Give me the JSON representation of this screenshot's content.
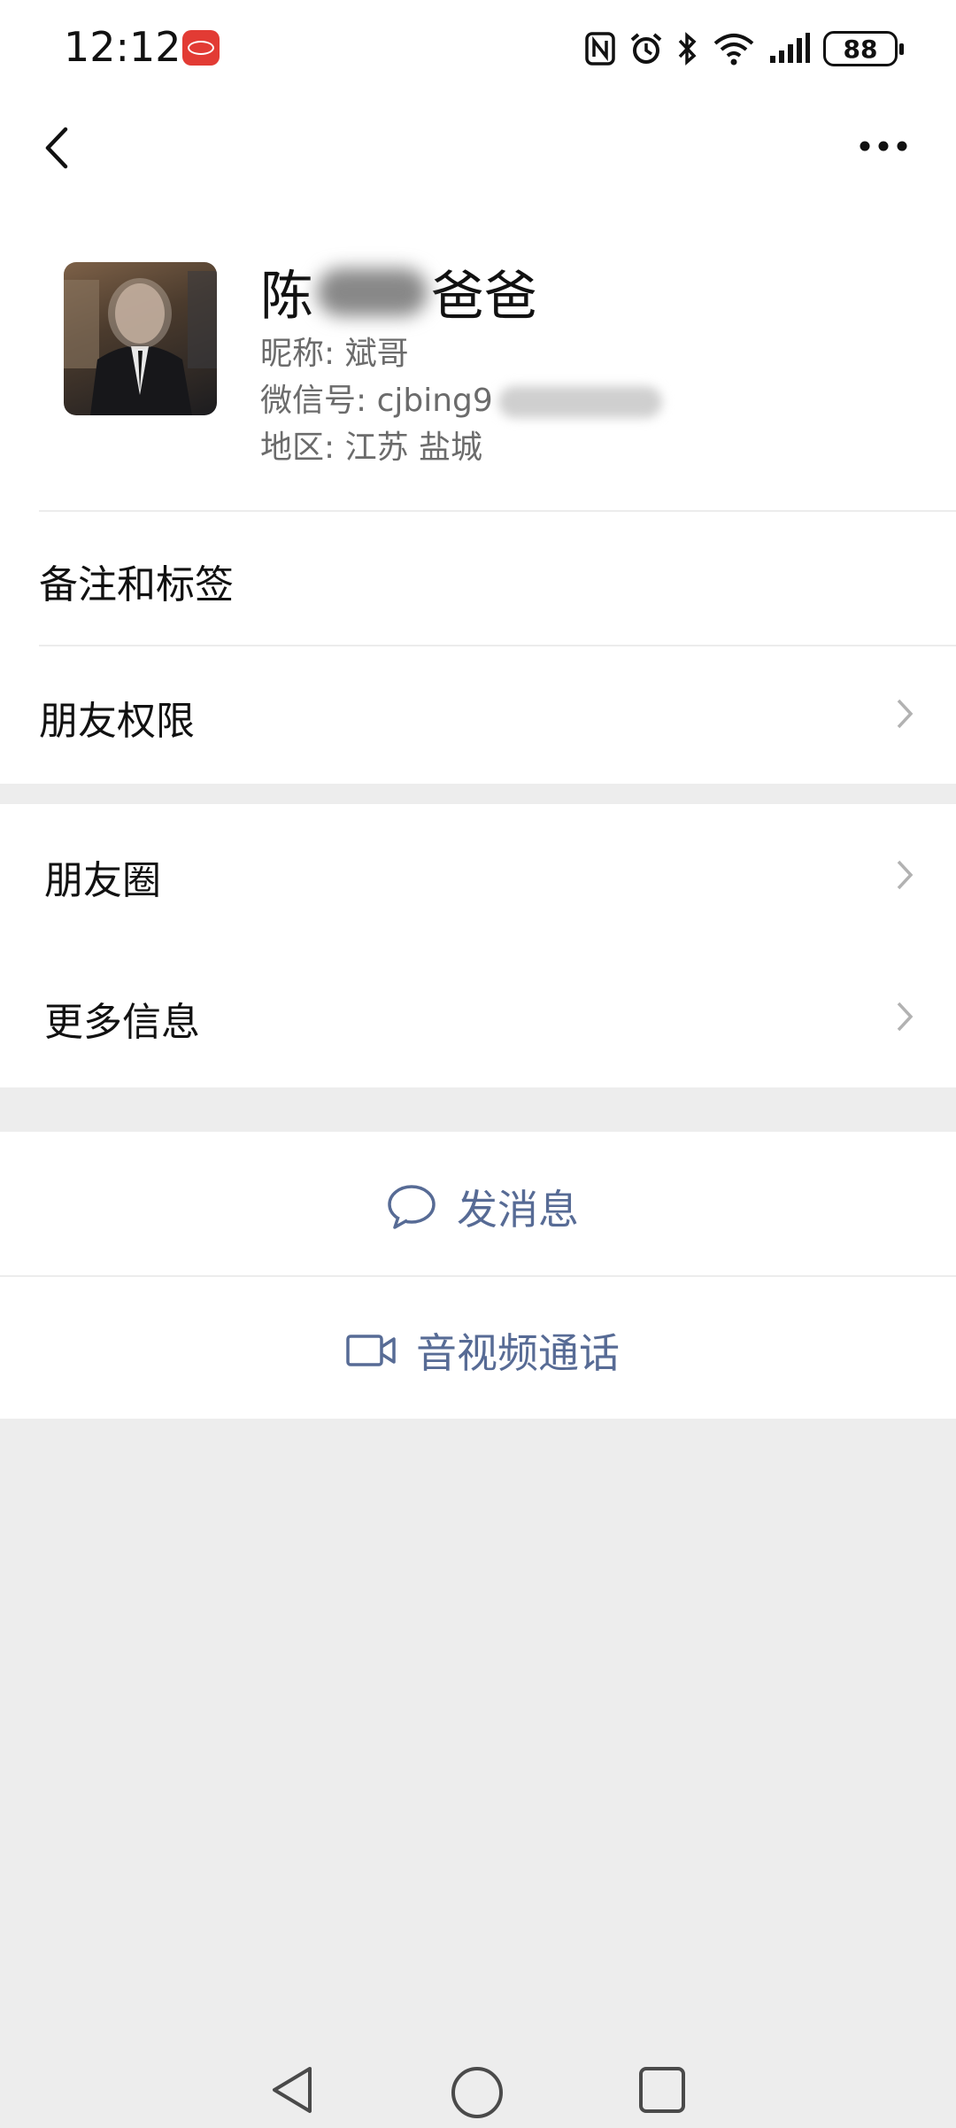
{
  "status_bar": {
    "time": "12:12",
    "battery": "88",
    "icons": [
      "byd-app-icon",
      "nfc-icon",
      "alarm-icon",
      "bluetooth-icon",
      "wifi-icon",
      "signal-icon",
      "battery-icon"
    ]
  },
  "nav": {
    "back_icon": "chevron-left-icon",
    "more_icon": "more-dots-icon"
  },
  "profile": {
    "name_start": "陈",
    "name_end": "爸爸",
    "nickname": "昵称: 斌哥",
    "wechat_id": "微信号: cjbing9",
    "region": "地区: 江苏 盐城"
  },
  "menu": {
    "remarks_tags": "备注和标签",
    "permissions": "朋友权限",
    "moments": "朋友圈",
    "more_info": "更多信息"
  },
  "actions": {
    "send_message": "发消息",
    "av_call": "音视频通话"
  },
  "colors": {
    "link": "#576b95",
    "background": "#ededed",
    "badge": "#e23b34"
  }
}
